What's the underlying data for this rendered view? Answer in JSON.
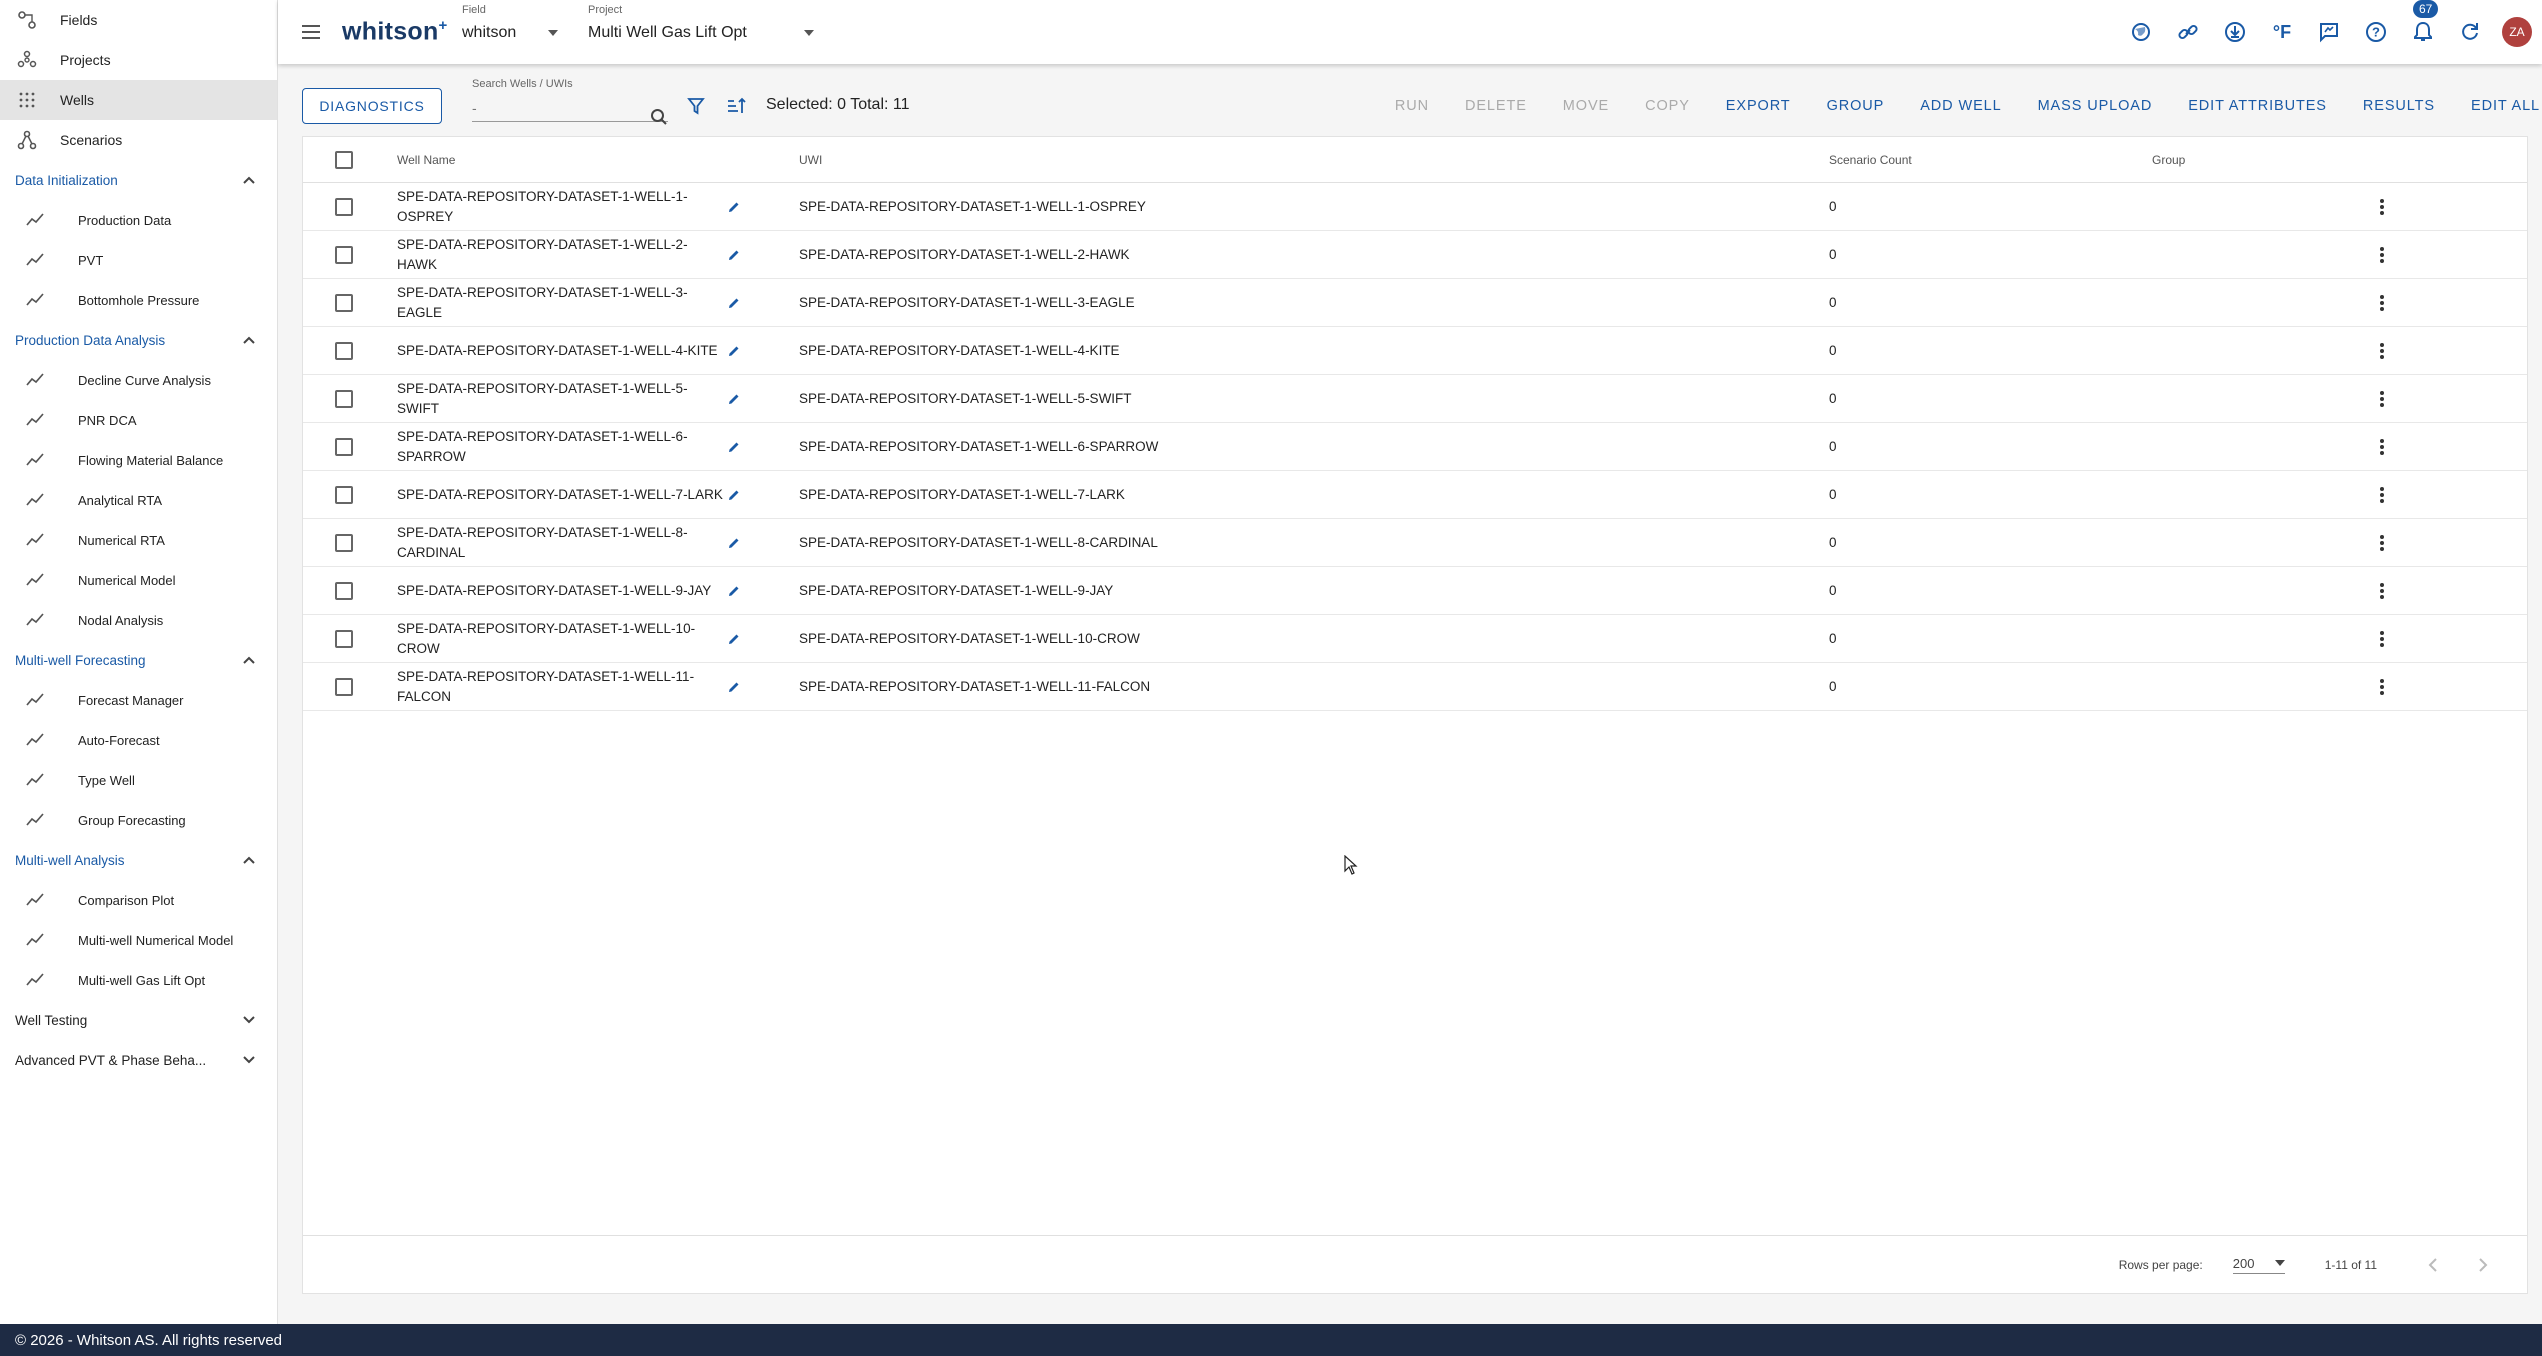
{
  "sidebar": {
    "top_items": [
      {
        "label": "Fields",
        "icon": "fields-icon"
      },
      {
        "label": "Projects",
        "icon": "projects-icon"
      },
      {
        "label": "Wells",
        "icon": "wells-icon",
        "active": true
      },
      {
        "label": "Scenarios",
        "icon": "scenarios-icon"
      }
    ],
    "sections": [
      {
        "title": "Data Initialization",
        "expanded": true,
        "items": [
          "Production Data",
          "PVT",
          "Bottomhole Pressure"
        ]
      },
      {
        "title": "Production Data Analysis",
        "expanded": true,
        "items": [
          "Decline Curve Analysis",
          "PNR DCA",
          "Flowing Material Balance",
          "Analytical RTA",
          "Numerical RTA",
          "Numerical Model",
          "Nodal Analysis"
        ]
      },
      {
        "title": "Multi-well Forecasting",
        "expanded": true,
        "items": [
          "Forecast Manager",
          "Auto-Forecast",
          "Type Well",
          "Group Forecasting"
        ]
      },
      {
        "title": "Multi-well Analysis",
        "expanded": true,
        "items": [
          "Comparison Plot",
          "Multi-well Numerical Model",
          "Multi-well Gas Lift Opt"
        ]
      },
      {
        "title": "Well Testing",
        "expanded": false,
        "items": []
      },
      {
        "title": "Advanced PVT & Phase Beha...",
        "expanded": false,
        "items": []
      }
    ]
  },
  "header": {
    "logo": "whitson",
    "logo_sup": "+",
    "field_label": "Field",
    "field_value": "whitson",
    "project_label": "Project",
    "project_value": "Multi Well Gas Lift Opt",
    "notification_count": "67",
    "avatar_initials": "ZA",
    "temp_unit": "°F"
  },
  "toolbar": {
    "diagnostics_label": "DIAGNOSTICS",
    "search_label": "Search Wells / UWIs",
    "search_placeholder": "-",
    "selection_text": "Selected: 0 Total: 11",
    "actions": [
      {
        "label": "RUN",
        "enabled": false
      },
      {
        "label": "DELETE",
        "enabled": false
      },
      {
        "label": "MOVE",
        "enabled": false
      },
      {
        "label": "COPY",
        "enabled": false
      },
      {
        "label": "EXPORT",
        "enabled": true
      },
      {
        "label": "GROUP",
        "enabled": true
      },
      {
        "label": "ADD WELL",
        "enabled": true
      },
      {
        "label": "MASS UPLOAD",
        "enabled": true
      },
      {
        "label": "EDIT ATTRIBUTES",
        "enabled": true
      },
      {
        "label": "RESULTS",
        "enabled": true
      },
      {
        "label": "EDIT ALL",
        "enabled": true
      }
    ]
  },
  "table": {
    "headers": {
      "name": "Well Name",
      "uwi": "UWI",
      "scenario_count": "Scenario Count",
      "group": "Group"
    },
    "rows": [
      {
        "name": "SPE-DATA-REPOSITORY-DATASET-1-WELL-1-OSPREY",
        "uwi": "SPE-DATA-REPOSITORY-DATASET-1-WELL-1-OSPREY",
        "scenario_count": "0",
        "group": ""
      },
      {
        "name": "SPE-DATA-REPOSITORY-DATASET-1-WELL-2-HAWK",
        "uwi": "SPE-DATA-REPOSITORY-DATASET-1-WELL-2-HAWK",
        "scenario_count": "0",
        "group": ""
      },
      {
        "name": "SPE-DATA-REPOSITORY-DATASET-1-WELL-3-EAGLE",
        "uwi": "SPE-DATA-REPOSITORY-DATASET-1-WELL-3-EAGLE",
        "scenario_count": "0",
        "group": ""
      },
      {
        "name": "SPE-DATA-REPOSITORY-DATASET-1-WELL-4-KITE",
        "uwi": "SPE-DATA-REPOSITORY-DATASET-1-WELL-4-KITE",
        "scenario_count": "0",
        "group": ""
      },
      {
        "name": "SPE-DATA-REPOSITORY-DATASET-1-WELL-5-SWIFT",
        "uwi": "SPE-DATA-REPOSITORY-DATASET-1-WELL-5-SWIFT",
        "scenario_count": "0",
        "group": ""
      },
      {
        "name": "SPE-DATA-REPOSITORY-DATASET-1-WELL-6-SPARROW",
        "uwi": "SPE-DATA-REPOSITORY-DATASET-1-WELL-6-SPARROW",
        "scenario_count": "0",
        "group": ""
      },
      {
        "name": "SPE-DATA-REPOSITORY-DATASET-1-WELL-7-LARK",
        "uwi": "SPE-DATA-REPOSITORY-DATASET-1-WELL-7-LARK",
        "scenario_count": "0",
        "group": ""
      },
      {
        "name": "SPE-DATA-REPOSITORY-DATASET-1-WELL-8-CARDINAL",
        "uwi": "SPE-DATA-REPOSITORY-DATASET-1-WELL-8-CARDINAL",
        "scenario_count": "0",
        "group": ""
      },
      {
        "name": "SPE-DATA-REPOSITORY-DATASET-1-WELL-9-JAY",
        "uwi": "SPE-DATA-REPOSITORY-DATASET-1-WELL-9-JAY",
        "scenario_count": "0",
        "group": ""
      },
      {
        "name": "SPE-DATA-REPOSITORY-DATASET-1-WELL-10-CROW",
        "uwi": "SPE-DATA-REPOSITORY-DATASET-1-WELL-10-CROW",
        "scenario_count": "0",
        "group": ""
      },
      {
        "name": "SPE-DATA-REPOSITORY-DATASET-1-WELL-11-FALCON",
        "uwi": "SPE-DATA-REPOSITORY-DATASET-1-WELL-11-FALCON",
        "scenario_count": "0",
        "group": ""
      }
    ],
    "footer": {
      "rows_per_page_label": "Rows per page:",
      "rows_per_page": "200",
      "range": "1-11 of 11"
    }
  },
  "footer": {
    "copyright": "© 2026 - Whitson AS. All rights reserved"
  },
  "colors": {
    "accent": "#1a5aa6",
    "footer_bg": "#1e2b44",
    "avatar": "#b0413e"
  }
}
